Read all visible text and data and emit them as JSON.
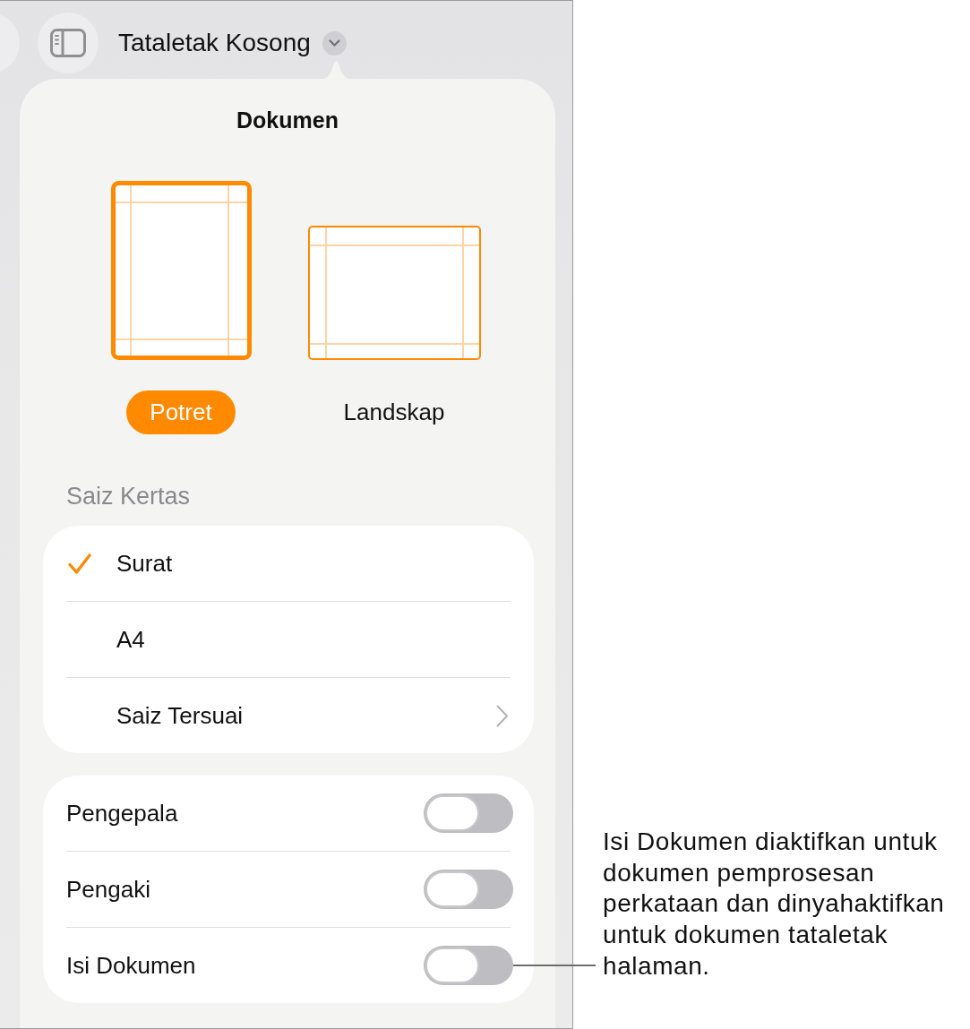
{
  "toolbar": {
    "title": "Tataletak Kosong"
  },
  "popover": {
    "title": "Dokumen",
    "orientations": [
      {
        "kind": "portrait",
        "label": "Potret",
        "selected": true
      },
      {
        "kind": "landscape",
        "label": "Landskap",
        "selected": false
      }
    ],
    "paper_size": {
      "heading": "Saiz Kertas",
      "options": [
        {
          "kind": "option",
          "label": "Surat",
          "selected": true
        },
        {
          "kind": "option",
          "label": "A4",
          "selected": false
        },
        {
          "kind": "submenu",
          "label": "Saiz Tersuai",
          "selected": false
        }
      ]
    },
    "switches": [
      {
        "label": "Pengepala",
        "on": false
      },
      {
        "label": "Pengaki",
        "on": false
      },
      {
        "label": "Isi Dokumen",
        "on": false
      }
    ]
  },
  "callout": {
    "text": "Isi Dokumen diaktifkan untuk dokumen pemprosesan perkataan dan dinyahaktifkan untuk dokumen tataletak halaman."
  }
}
